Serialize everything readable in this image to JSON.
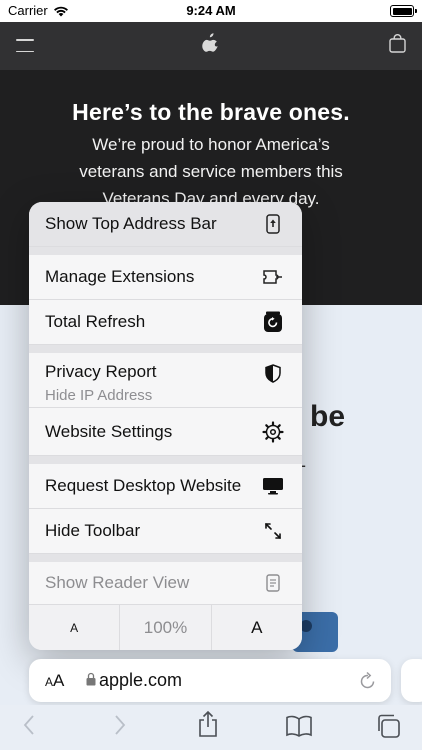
{
  "status_bar": {
    "carrier": "Carrier",
    "time": "9:24 AM"
  },
  "nav": {
    "icons": [
      "menu-icon",
      "apple-logo-icon",
      "shopping-bag-icon"
    ]
  },
  "hero": {
    "title": "Here’s to the brave ones.",
    "body": "We’re proud to honor America’s veterans and service members this Veterans Day and every day."
  },
  "background": {
    "partial_word": "be",
    "partial_dash": "-"
  },
  "menu": {
    "show_top_address_bar": "Show Top Address Bar",
    "manage_extensions": "Manage Extensions",
    "total_refresh": "Total Refresh",
    "privacy_report": "Privacy Report",
    "privacy_report_sub": "Hide IP Address",
    "website_settings": "Website Settings",
    "request_desktop_website": "Request Desktop Website",
    "hide_toolbar": "Hide Toolbar",
    "show_reader_view": "Show Reader View",
    "font_smaller": "A",
    "zoom_level": "100%",
    "font_larger": "A"
  },
  "address_bar": {
    "aa_small": "A",
    "aa_large": "A",
    "url": "apple.com"
  },
  "toolbar": {
    "icons": [
      "back-icon",
      "forward-icon",
      "share-icon",
      "bookmarks-icon",
      "tabs-icon"
    ]
  },
  "colors": {
    "hero_bg": "#1f1f20",
    "nav_bg": "#313133",
    "menu_bg": "#f6f6f7",
    "page_bg": "#e7edf5"
  }
}
